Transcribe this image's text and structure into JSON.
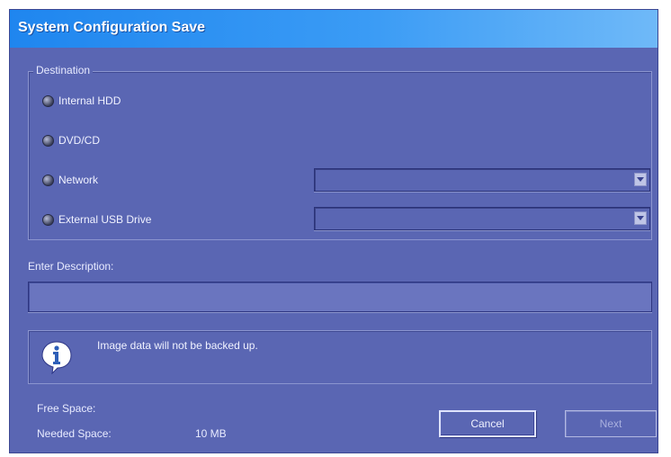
{
  "window": {
    "title": "System Configuration Save"
  },
  "destination": {
    "group_label": "Destination",
    "options": [
      {
        "label": "Internal HDD"
      },
      {
        "label": "DVD/CD"
      },
      {
        "label": "Network"
      },
      {
        "label": "External USB Drive"
      }
    ],
    "network_select": {
      "value": ""
    },
    "usb_select": {
      "value": ""
    }
  },
  "description": {
    "label": "Enter Description:",
    "value": ""
  },
  "info": {
    "message": "Image data will not be backed up."
  },
  "space": {
    "free_label": "Free Space:",
    "free_value": "",
    "needed_label": "Needed Space:",
    "needed_value": "10 MB"
  },
  "buttons": {
    "cancel": "Cancel",
    "next": "Next"
  }
}
